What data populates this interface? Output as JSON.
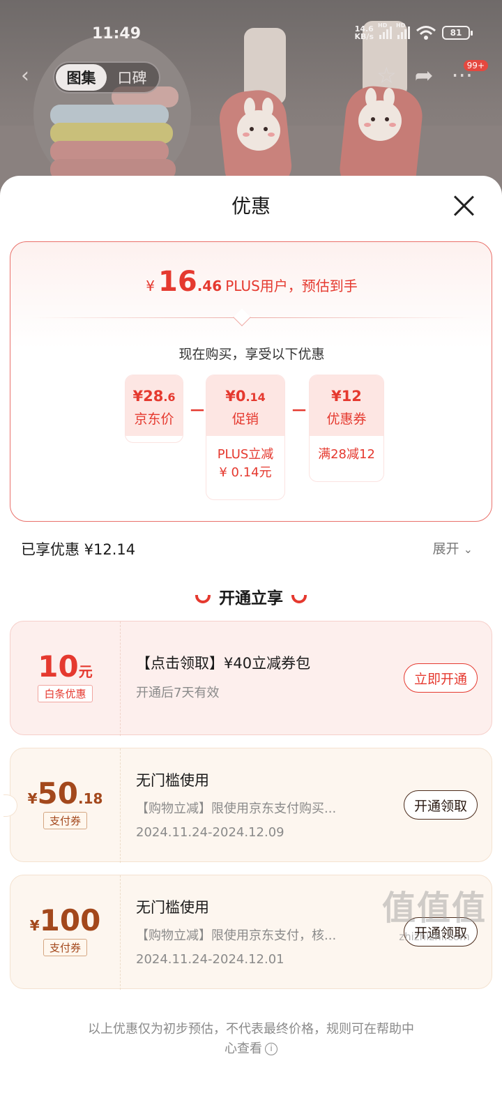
{
  "status_bar": {
    "time": "11:49",
    "net_speed_value": "14.6",
    "net_speed_unit": "KB/s",
    "hd_label": "HD",
    "battery": "81"
  },
  "nav": {
    "tabs": [
      {
        "label": "图集",
        "active": true
      },
      {
        "label": "口碑",
        "active": false
      }
    ],
    "badge": "99+"
  },
  "sheet": {
    "title": "优惠",
    "estimate": {
      "currency": "¥",
      "int": "16",
      "dec": ".46",
      "note": "PLUS用户，预估到手"
    },
    "buy_note": "现在购买，享受以下优惠",
    "breakdown": [
      {
        "value_main": "¥28",
        "value_dec": ".6",
        "label": "京东价"
      },
      {
        "value_main": "¥0",
        "value_dec": ".14",
        "label": "促销",
        "sub_line1": "PLUS立减",
        "sub_line2": "¥ 0.14元"
      },
      {
        "value_main": "¥12",
        "value_dec": "",
        "label": "优惠券",
        "sub_line1": "满28减12"
      }
    ],
    "operator": "－",
    "enjoyed": "已享优惠 ¥12.14",
    "expand": "展开",
    "open_title": "开通立享",
    "coupons": [
      {
        "amount_big": "10",
        "amount_unit": "元",
        "tag": "白条优惠",
        "title": "【点击领取】¥40立减券包",
        "desc": "开通后7天有效",
        "button": "立即开通"
      },
      {
        "currency": "¥",
        "amount_big": "50",
        "amount_small": ".18",
        "tag": "支付券",
        "title": "无门槛使用",
        "desc": "【购物立减】限使用京东支付购买...",
        "date": "2024.11.24-2024.12.09",
        "button": "开通领取"
      },
      {
        "currency": "¥",
        "amount_big": "100",
        "tag": "支付券",
        "title": "无门槛使用",
        "desc": "【购物立减】限使用京东支付，核...",
        "date": "2024.11.24-2024.12.01",
        "button": "开通领取"
      }
    ],
    "footer_line1": "以上优惠仅为初步预估，不代表最终价格，规则可在帮助中",
    "footer_line2": "心查看"
  },
  "watermark": {
    "glyphs": "值值值",
    "url": "zhizhizhi.com"
  },
  "colors": {
    "accent_red": "#e5392f",
    "brown": "#a3481c"
  }
}
